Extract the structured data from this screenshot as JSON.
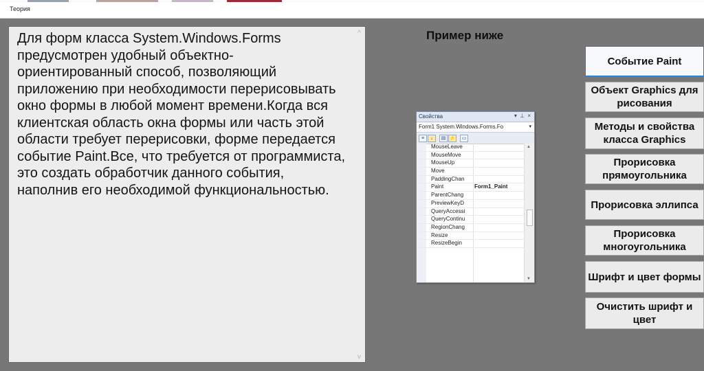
{
  "window": {
    "title": "Теория"
  },
  "main": {
    "text": "Для форм класса System.Windows.Forms предусмотрен удобный объектно-ориентированный способ, позволяющий приложению при необходимости перерисовывать окно формы в любой момент времени.Когда вся клиентская область окна формы или часть этой области требует перерисовки, форме передается событие Paint.Все, что требуется от программиста, это создать обработчик данного события, наполнив его необходимой функциональностью.",
    "example_label": "Пример ниже"
  },
  "properties_panel": {
    "title": "Свойства",
    "controls": "▾ ⊥ ×",
    "object": "Form1 System.Windows.Forms.Fo",
    "rows": [
      {
        "name": "MouseLeave",
        "value": ""
      },
      {
        "name": "MouseMove",
        "value": ""
      },
      {
        "name": "MouseUp",
        "value": ""
      },
      {
        "name": "Move",
        "value": ""
      },
      {
        "name": "PaddingChan",
        "value": ""
      },
      {
        "name": "Paint",
        "value": "Form1_Paint"
      },
      {
        "name": "ParentChang",
        "value": ""
      },
      {
        "name": "PreviewKeyD",
        "value": ""
      },
      {
        "name": "QueryAccessi",
        "value": ""
      },
      {
        "name": "QueryContinu",
        "value": ""
      },
      {
        "name": "RegionChang",
        "value": ""
      },
      {
        "name": "Resize",
        "value": ""
      },
      {
        "name": "ResizeBegin",
        "value": ""
      }
    ]
  },
  "buttons": [
    {
      "label": "Событие Paint"
    },
    {
      "label": "Объект Graphics для рисования"
    },
    {
      "label": "Методы и свойства класса Graphics"
    },
    {
      "label": "Прорисовка прямоугольника"
    },
    {
      "label": "Прорисовка эллипса"
    },
    {
      "label": "Прорисовка многоугольника"
    },
    {
      "label": "Шрифт и цвет формы"
    },
    {
      "label": "Очистить шрифт и цвет"
    }
  ],
  "colors": {
    "client_bg": "#777777",
    "textbox_bg": "#ededed",
    "button_bg": "#ebebeb",
    "active_border": "#1a7ad4"
  }
}
